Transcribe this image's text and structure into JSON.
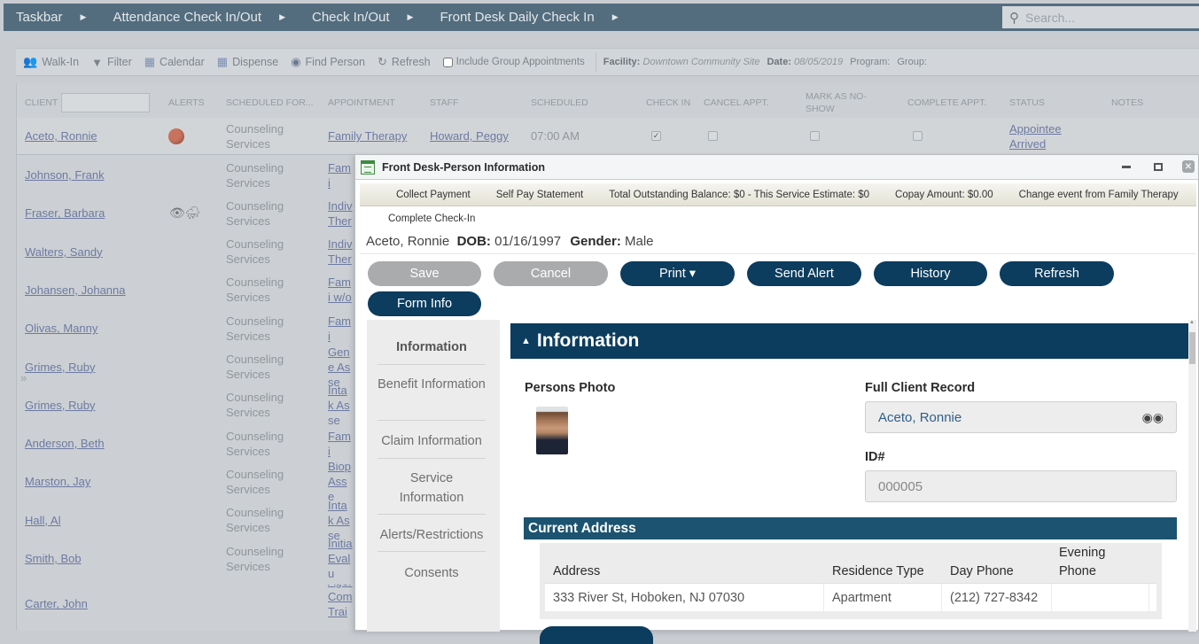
{
  "breadcrumb": {
    "items": [
      "Taskbar",
      "Attendance Check In/Out",
      "Check In/Out",
      "Front Desk Daily Check In"
    ],
    "separator_icon": "triangle-right-icon"
  },
  "search": {
    "placeholder": "Search...",
    "icon": "search-icon"
  },
  "toolbar": {
    "walk_in": "Walk-In",
    "filter": "Filter",
    "calendar": "Calendar",
    "dispense": "Dispense",
    "find_person": "Find Person",
    "refresh": "Refresh",
    "include_group": "Include Group Appointments",
    "include_group_checked": false,
    "facility_label": "Facility:",
    "facility_value": "Downtown Community Site",
    "date_label": "Date:",
    "date_value": "08/05/2019",
    "program_label": "Program:",
    "group_label": "Group:"
  },
  "grid": {
    "columns": {
      "client": "CLIENT",
      "alerts": "ALERTS",
      "scheduled_for": "SCHEDULED FOR...",
      "appointment": "APPOINTMENT",
      "staff": "STAFF",
      "scheduled": "SCHEDULED",
      "check_in": "CHECK IN",
      "cancel": "CANCEL APPT.",
      "no_show": "MARK AS NO-SHOW",
      "complete": "COMPLETE APPT.",
      "status": "STATUS",
      "notes": "NOTES"
    },
    "client_filter_value": "",
    "first_row": {
      "client": "Aceto, Ronnie",
      "alert": "red-alert-icon",
      "scheduled_for": "Counseling Services",
      "appointment": "Family Therapy",
      "staff": "Howard, Peggy",
      "scheduled": "07:00 AM",
      "check_in": true,
      "cancel": false,
      "no_show": false,
      "complete": false,
      "status": "Appointee Arrived"
    },
    "rows": [
      {
        "client": "Johnson, Frank",
        "scheduled_for": "Counseling Services",
        "appointment": "Fami"
      },
      {
        "client": "Fraser, Barbara",
        "scheduled_for": "Counseling Services",
        "appointment": "Indiv Ther",
        "alert": "eye-storm-icon"
      },
      {
        "client": "Walters, Sandy",
        "scheduled_for": "Counseling Services",
        "appointment": "Indiv Ther"
      },
      {
        "client": "Johansen, Johanna",
        "scheduled_for": "Counseling Services",
        "appointment": "Fami w/o"
      },
      {
        "client": "Olivas, Manny",
        "scheduled_for": "Counseling Services",
        "appointment": "Fami"
      },
      {
        "client": "Grimes, Ruby",
        "scheduled_for": "Counseling Services",
        "appointment": "Gene Asse"
      },
      {
        "client": "Grimes, Ruby",
        "scheduled_for": "Counseling Services",
        "appointment": "Intak Asse"
      },
      {
        "client": "Anderson, Beth",
        "scheduled_for": "Counseling Services",
        "appointment": "Fami"
      },
      {
        "client": "Marston, Jay",
        "scheduled_for": "Counseling Services",
        "appointment": "Biop Asse"
      },
      {
        "client": "Hall, Al",
        "scheduled_for": "Counseling Services",
        "appointment": "Intak Asse"
      },
      {
        "client": "Smith, Bob",
        "scheduled_for": "Counseling Services",
        "appointment": "Initia Evalu"
      },
      {
        "client": "Carter, John",
        "scheduled_for": "",
        "appointment": "Ager Com Train"
      }
    ]
  },
  "modal": {
    "title": "Front Desk-Person Information",
    "bar": {
      "collect_payment": "Collect Payment",
      "self_pay": "Self Pay Statement",
      "balance": "Total Outstanding Balance: $0 - This Service Estimate: $0",
      "copay": "Copay Amount: $0.00",
      "change_event": "Change event from Family Therapy"
    },
    "complete_checkin": "Complete Check-In",
    "person": {
      "name": "Aceto, Ronnie",
      "dob_label": "DOB:",
      "dob": "01/16/1997",
      "gender_label": "Gender:",
      "gender": "Male"
    },
    "buttons": {
      "save": "Save",
      "cancel": "Cancel",
      "print": "Print ▾",
      "send_alert": "Send Alert",
      "history": "History",
      "refresh": "Refresh",
      "form_info": "Form Info"
    },
    "nav": [
      "Information",
      "Benefit Information",
      "Claim Information",
      "Service Information",
      "Alerts/Restrictions",
      "Consents"
    ],
    "section": {
      "title": "Information",
      "photo_label": "Persons Photo",
      "full_record_label": "Full Client Record",
      "full_record_value": "Aceto, Ronnie",
      "id_label": "ID#",
      "id_value": "000005"
    },
    "address": {
      "title": "Current Address",
      "columns": [
        "Address",
        "Residence Type",
        "Day Phone",
        "Evening Phone"
      ],
      "rows": [
        [
          "333 River St, Hoboken, NJ 07030",
          "Apartment",
          "(212) 727-8342",
          ""
        ]
      ]
    }
  }
}
